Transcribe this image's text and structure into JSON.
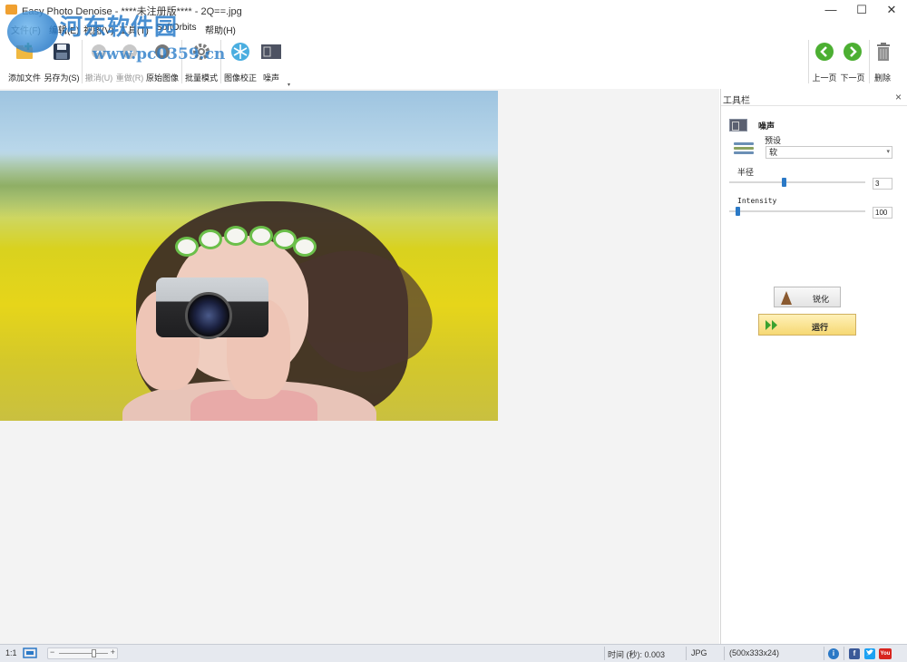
{
  "window": {
    "title": "Easy Photo Denoise - ****未注册版**** - 2Q==.jpg",
    "minimize": "—",
    "maximize": "☐",
    "close": "✕"
  },
  "menu": [
    {
      "label": "文件(F)"
    },
    {
      "label": "编辑(E)"
    },
    {
      "label": "视图(V)"
    },
    {
      "label": "工具(T)"
    },
    {
      "label": "SoftOrbits"
    },
    {
      "label": "帮助(H)"
    }
  ],
  "watermark": {
    "text": "河东软件园",
    "url": "www.pc0359.cn"
  },
  "toolbar": {
    "add_file": "添加文件",
    "save_as": "另存为(S)",
    "undo": "撤消(U)",
    "redo": "重做(R)",
    "original": "原始图像",
    "batch": "批量模式",
    "correction": "图像校正",
    "noise": "噪声",
    "prev": "上一页",
    "next": "下一页",
    "delete": "删除",
    "more": "▾"
  },
  "panel": {
    "title": "工具栏",
    "close": "×",
    "noise_label": "噪声",
    "preset_label": "预设",
    "preset_value": "软",
    "radius_label": "半径",
    "radius_value": "3",
    "radius_fraction": 0.4,
    "intensity_label": "Intensity",
    "intensity_value": "100",
    "intensity_fraction": 0.05,
    "sharpen_button": "锐化",
    "run_button": "运行"
  },
  "status": {
    "zoom_ratio": "1:1",
    "zoom_minus": "−",
    "zoom_plus": "+",
    "time": "时间 (秒): 0.003",
    "format": "JPG",
    "dimensions": "(500x333x24)",
    "info_icon": "i",
    "facebook": "f",
    "youtube": "You"
  },
  "colors": {
    "accent": "#2b79c6",
    "run_button": "#f6d873",
    "green_nav": "#4caf32"
  }
}
